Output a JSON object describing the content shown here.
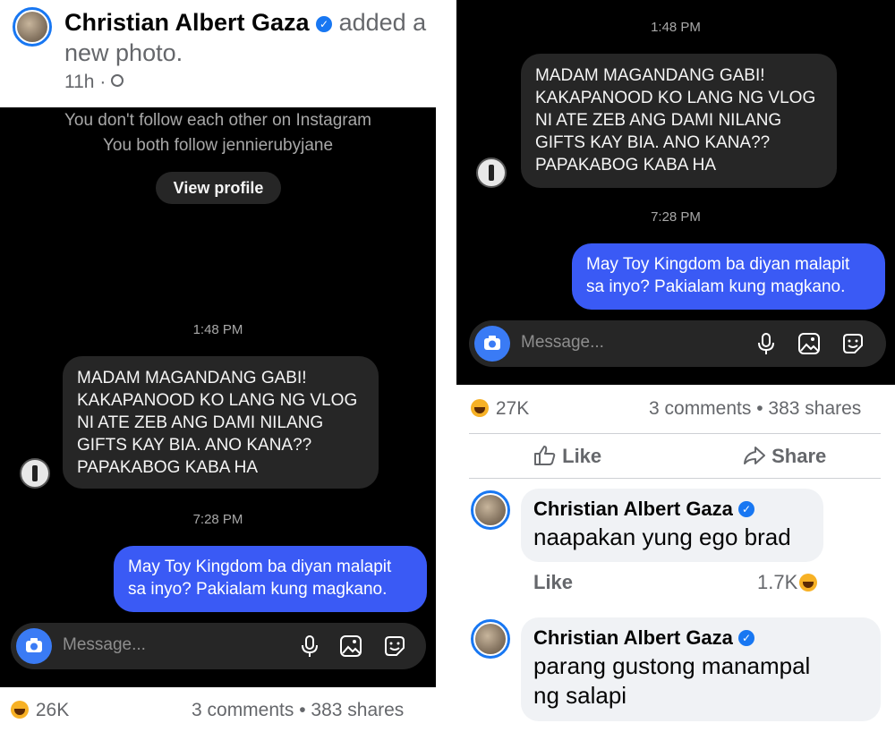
{
  "left": {
    "header": {
      "author": "Christian Albert Gaza",
      "action": "added a new photo.",
      "time": "11h",
      "separator": "·"
    },
    "dm": {
      "follow_line1": "You don't follow each other on Instagram",
      "follow_line2": "You both follow jennierubyjane",
      "view_profile": "View profile",
      "time1": "1:48 PM",
      "incoming": "MADAM MAGANDANG GABI!\nKAKAPANOOD KO LANG NG VLOG\nNI ATE ZEB ANG DAMI NILANG\nGIFTS KAY BIA. ANO KANA??\nPAPAKABOG KABA HA",
      "time2": "7:28 PM",
      "outgoing": "May Toy Kingdom ba diyan malapit\nsa inyo? Pakialam kung magkano.",
      "placeholder": "Message..."
    },
    "stats": {
      "reactions": "26K",
      "comments_shares": "3 comments • 383 shares"
    }
  },
  "right": {
    "dm": {
      "time1": "1:48 PM",
      "incoming": "MADAM MAGANDANG GABI!\nKAKAPANOOD KO LANG NG VLOG\nNI ATE ZEB ANG DAMI NILANG\nGIFTS KAY BIA. ANO KANA??\nPAPAKABOG KABA HA",
      "time2": "7:28 PM",
      "outgoing": "May Toy Kingdom ba diyan malapit\nsa inyo? Pakialam kung magkano.",
      "placeholder": "Message..."
    },
    "stats": {
      "reactions": "27K",
      "comments_shares": "3 comments • 383 shares"
    },
    "actions": {
      "like": "Like",
      "share": "Share"
    },
    "comments": [
      {
        "name": "Christian Albert Gaza",
        "text": "naapakan yung ego brad",
        "like": "Like",
        "reactions": "1.7K"
      },
      {
        "name": "Christian Albert Gaza",
        "text_line1": "parang gustong manampal",
        "text_line2": "ng salapi"
      }
    ]
  },
  "colors": {
    "facebook_blue": "#1877f2",
    "dm_background": "#000000",
    "incoming_bubble": "#262626",
    "outgoing_bubble": "#3a5af5"
  }
}
